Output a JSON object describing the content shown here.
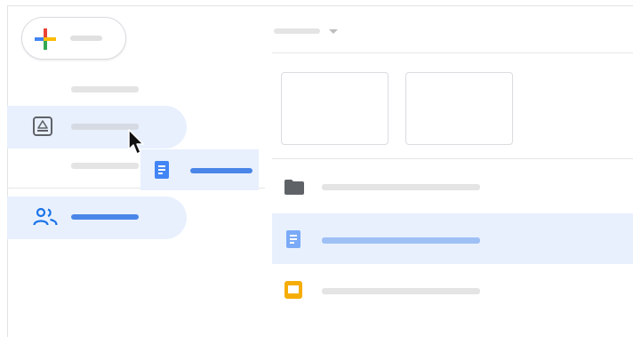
{
  "sidebar": {
    "new_button": {
      "label": ""
    },
    "items": [
      {
        "label": "",
        "icon": "none"
      },
      {
        "label": "",
        "icon": "my-drive-icon",
        "state": "drop-target-hover"
      },
      {
        "label": "",
        "icon": "none"
      },
      {
        "label": "",
        "icon": "shared-with-me-icon",
        "state": "selected"
      }
    ]
  },
  "drag": {
    "label": "",
    "icon": "doc-icon"
  },
  "main": {
    "sort": {
      "label": "",
      "icon": "caret-down-icon"
    },
    "quick_access": [
      {
        "label": ""
      },
      {
        "label": ""
      }
    ],
    "files": [
      {
        "name": "",
        "icon": "folder-icon"
      },
      {
        "name": "",
        "icon": "doc-icon",
        "state": "selected"
      },
      {
        "name": "",
        "icon": "slides-icon"
      }
    ]
  },
  "colors": {
    "selection": "#e8f0fe",
    "accent_blue": "#4285f4",
    "slides_yellow": "#f6ad08",
    "folder_gray": "#5f6368",
    "placeholder_gray": "#e4e4e4"
  }
}
